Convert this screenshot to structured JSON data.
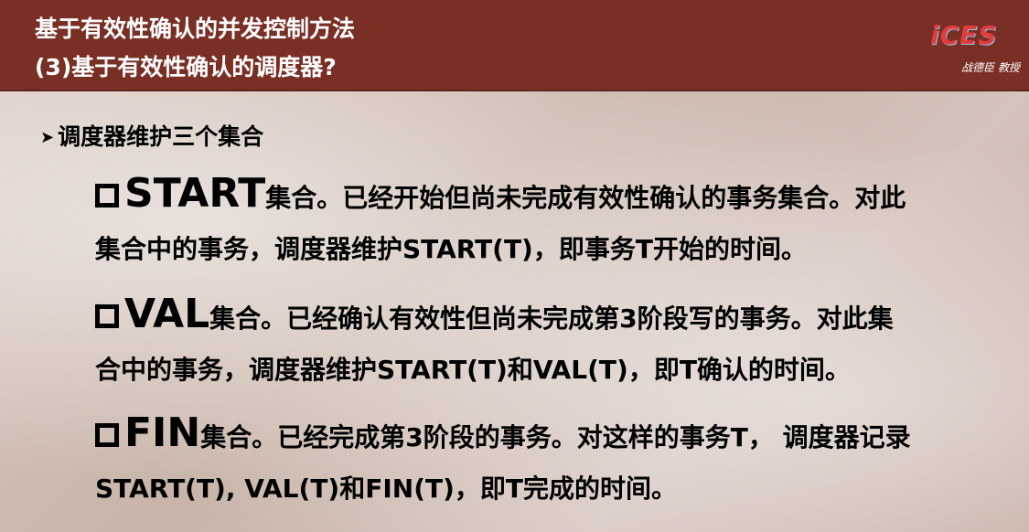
{
  "header": {
    "title_line1": "基于有效性确认的并发控制方法",
    "title_line2": "(3)基于有效性确认的调度器?",
    "logo_text": "iCES",
    "logo_caption": "战德臣 教授"
  },
  "bullet": {
    "text": "调度器维护三个集合"
  },
  "items": [
    {
      "term": "START",
      "line1_rest": "集合。已经开始但尚未完成有效性确认的事务集合。对此",
      "line2": "集合中的事务，调度器维护START(T)，即事务T开始的时间。"
    },
    {
      "term": "VAL",
      "line1_rest": "集合。已经确认有效性但尚未完成第3阶段写的事务。对此集",
      "line2": "合中的事务，调度器维护START(T)和VAL(T)，即T确认的时间。"
    },
    {
      "term": "FIN",
      "line1_rest": "集合。已经完成第3阶段的事务。对这样的事务T，  调度器记录",
      "line2": "START(T), VAL(T)和FIN(T)，即T完成的时间。"
    }
  ]
}
